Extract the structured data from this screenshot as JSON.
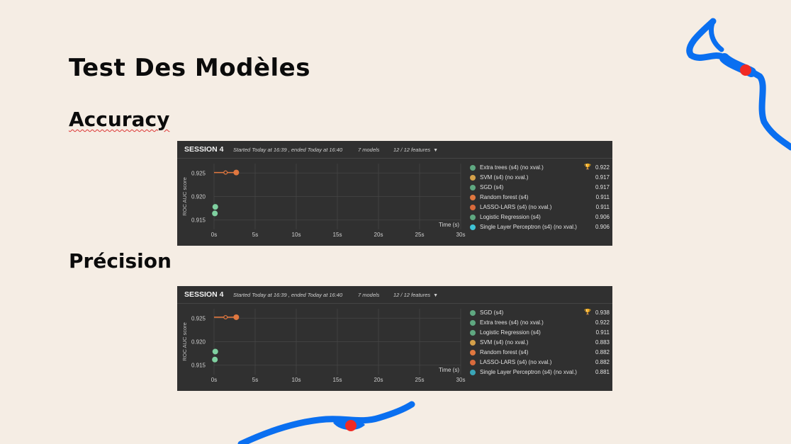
{
  "slide": {
    "title": "Test Des Modèles",
    "section_accuracy": "Accuracy",
    "section_precision": "Précision"
  },
  "colors": {
    "background": "#f5ede4",
    "panel": "#303030",
    "decor_blue": "#0a6ff0",
    "decor_red": "#f02a24"
  },
  "panels": [
    {
      "session": "SESSION 4",
      "started": "Started Today at 16:39 , ended Today at 16:40",
      "models": "7 models",
      "features": "12 / 12 features",
      "ylabel": "ROC AUC score",
      "xlabel": "Time (s)",
      "legend": [
        {
          "name": "Extra trees (s4) (no xval.)",
          "value": "0.922",
          "color": "#5fa881",
          "best": true
        },
        {
          "name": "SVM (s4) (no xval.)",
          "value": "0.917",
          "color": "#d4a04a",
          "best": false
        },
        {
          "name": "SGD (s4)",
          "value": "0.917",
          "color": "#5fa881",
          "best": false
        },
        {
          "name": "Random forest (s4)",
          "value": "0.911",
          "color": "#e0773f",
          "best": false
        },
        {
          "name": "LASSO-LARS (s4) (no xval.)",
          "value": "0.911",
          "color": "#d96a3c",
          "best": false
        },
        {
          "name": "Logistic Regression (s4)",
          "value": "0.906",
          "color": "#5fa881",
          "best": false
        },
        {
          "name": "Single Layer Perceptron (s4) (no xval.)",
          "value": "0.906",
          "color": "#3fc3d6",
          "best": false
        }
      ]
    },
    {
      "session": "SESSION 4",
      "started": "Started Today at 16:39 , ended Today at 16:40",
      "models": "7 models",
      "features": "12 / 12 features",
      "ylabel": "ROC AUC score",
      "xlabel": "Time (s)",
      "legend": [
        {
          "name": "SGD (s4)",
          "value": "0.938",
          "color": "#5fa881",
          "best": true
        },
        {
          "name": "Extra trees (s4) (no xval.)",
          "value": "0.922",
          "color": "#5fa881",
          "best": false
        },
        {
          "name": "Logistic Regression (s4)",
          "value": "0.911",
          "color": "#5fa881",
          "best": false
        },
        {
          "name": "SVM (s4) (no xval.)",
          "value": "0.883",
          "color": "#d4a04a",
          "best": false
        },
        {
          "name": "Random forest (s4)",
          "value": "0.882",
          "color": "#e0773f",
          "best": false
        },
        {
          "name": "LASSO-LARS (s4) (no xval.)",
          "value": "0.882",
          "color": "#d96a3c",
          "best": false
        },
        {
          "name": "Single Layer Perceptron (s4) (no xval.)",
          "value": "0.881",
          "color": "#3aa6b8",
          "best": false
        }
      ]
    }
  ],
  "chart_data": [
    {
      "type": "scatter",
      "title": "",
      "xlabel": "Time (s)",
      "ylabel": "ROC AUC score",
      "x_ticks": [
        "0s",
        "5s",
        "10s",
        "15s",
        "20s",
        "25s",
        "30s"
      ],
      "y_ticks": [
        "0.915",
        "0.920",
        "0.925"
      ],
      "xlim": [
        0,
        30
      ],
      "ylim": [
        0.913,
        0.927
      ],
      "grid": true,
      "line": {
        "x": [
          0.0,
          1.4,
          2.7
        ],
        "y": [
          0.9251,
          0.9251,
          0.9251
        ],
        "color": "#e0773f"
      },
      "points": [
        {
          "x": 1.4,
          "y": 0.9251,
          "color": "#e0773f",
          "hollow": true
        },
        {
          "x": 2.7,
          "y": 0.9251,
          "color": "#e0773f",
          "hollow": false
        },
        {
          "x": 0.15,
          "y": 0.9178,
          "color": "#7fd0a0",
          "hollow": false
        },
        {
          "x": 0.1,
          "y": 0.9164,
          "color": "#7fd0a0",
          "hollow": false
        }
      ]
    },
    {
      "type": "scatter",
      "title": "",
      "xlabel": "Time (s)",
      "ylabel": "ROC AUC score",
      "x_ticks": [
        "0s",
        "5s",
        "10s",
        "15s",
        "20s",
        "25s",
        "30s"
      ],
      "y_ticks": [
        "0.915",
        "0.920",
        "0.925"
      ],
      "xlim": [
        0,
        30
      ],
      "ylim": [
        0.913,
        0.927
      ],
      "grid": true,
      "line": {
        "x": [
          0.0,
          1.4,
          2.7
        ],
        "y": [
          0.9252,
          0.9252,
          0.9252
        ],
        "color": "#e0773f"
      },
      "points": [
        {
          "x": 1.4,
          "y": 0.9252,
          "color": "#e0773f",
          "hollow": true
        },
        {
          "x": 2.7,
          "y": 0.9252,
          "color": "#e0773f",
          "hollow": false
        },
        {
          "x": 0.15,
          "y": 0.9179,
          "color": "#7fd0a0",
          "hollow": false
        },
        {
          "x": 0.1,
          "y": 0.9162,
          "color": "#7fd0a0",
          "hollow": false
        }
      ]
    }
  ]
}
